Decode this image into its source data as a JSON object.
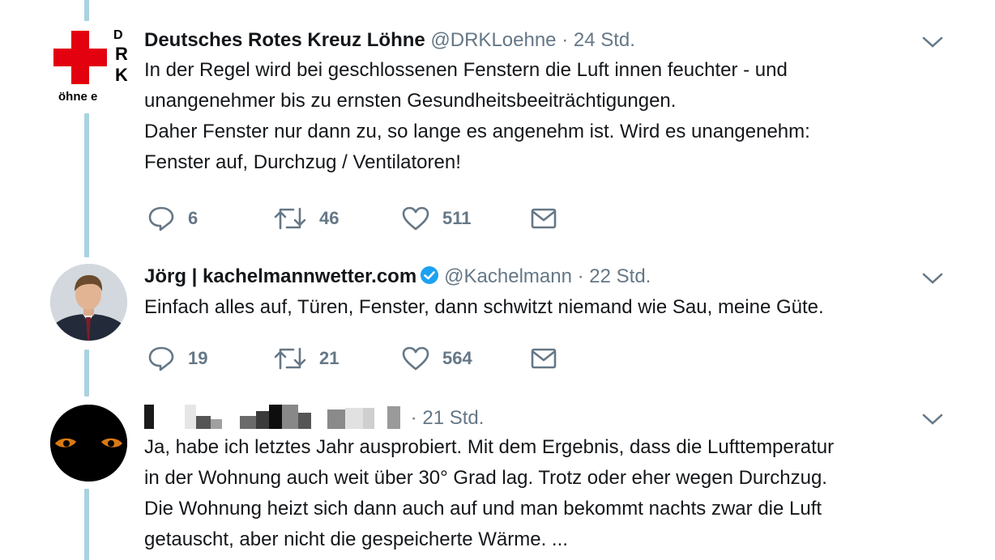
{
  "tweets": [
    {
      "display_name": "Deutsches Rotes Kreuz Löhne",
      "handle": "@DRKLoehne",
      "separator": "·",
      "time": "24 Std.",
      "avatar_logo_text": "DRK Löhne e",
      "lines": [
        "In der Regel wird bei geschlossenen Fenstern die Luft innen feuchter - und",
        "unangenehmer bis zu ernsten Gesundheitsbeeiträchtigungen.",
        "Daher Fenster nur dann zu, so lange es angenehm ist. Wird es unangenehm:",
        "Fenster auf, Durchzug / Ventilatoren!"
      ],
      "replies": "6",
      "retweets": "46",
      "likes": "511"
    },
    {
      "display_name": "Jörg | kachelmannwetter.com",
      "handle": "@Kachelmann",
      "separator": "·",
      "time": "22 Std.",
      "verified": true,
      "lines": [
        "Einfach alles auf, Türen, Fenster, dann schwitzt niemand wie Sau, meine Güte."
      ],
      "replies": "19",
      "retweets": "21",
      "likes": "564"
    },
    {
      "display_name": "",
      "handle": "",
      "separator": "·",
      "time": "21 Std.",
      "name_obscured": true,
      "lines": [
        "Ja, habe ich letztes Jahr ausprobiert. Mit dem Ergebnis, dass die Lufttemperatur",
        "in der Wohnung auch weit über 30° Grad lag. Trotz oder eher wegen Durchzug.",
        "Die Wohnung heizt sich dann auch auf und man bekommt nachts zwar die Luft",
        "getauscht, aber nicht die gespeicherte Wärme. ..."
      ]
    }
  ],
  "icons": {
    "reply": "reply-icon",
    "retweet": "retweet-icon",
    "like": "heart-icon",
    "message": "direct-message-icon",
    "more": "chevron-down-icon",
    "verified": "verified-badge-icon"
  },
  "colors": {
    "thread_line": "#a9d3e0",
    "verified": "#1da1f2",
    "muted_text": "#657786",
    "drk_red": "#e3000f"
  }
}
